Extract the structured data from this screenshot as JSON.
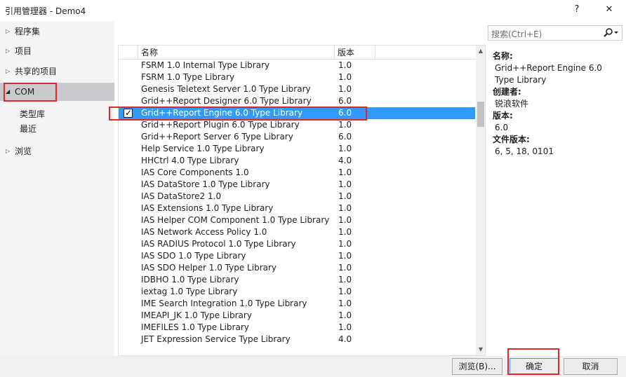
{
  "window": {
    "title": "引用管理器 - Demo4",
    "help_label": "?",
    "close_label": "✕"
  },
  "sidebar": {
    "items": [
      {
        "label": "程序集",
        "arrow": "▷"
      },
      {
        "label": "项目",
        "arrow": "▷"
      },
      {
        "label": "共享的项目",
        "arrow": "▷"
      },
      {
        "label": "COM",
        "arrow": "◢"
      },
      {
        "label": "浏览",
        "arrow": "▷"
      }
    ],
    "sub_items": [
      "类型库",
      "最近"
    ]
  },
  "list": {
    "columns": [
      "名称",
      "版本"
    ],
    "rows": [
      {
        "name": "FSRM 1.0 Internal Type Library",
        "version": "1.0"
      },
      {
        "name": "FSRM 1.0 Type Library",
        "version": "1.0"
      },
      {
        "name": "Genesis Teletext Server 1.0 Type Library",
        "version": "1.0"
      },
      {
        "name": "Grid++Report Designer 6.0 Type Library",
        "version": "6.0"
      },
      {
        "name": "Grid++Report Engine 6.0 Type Library",
        "version": "6.0",
        "checked": true
      },
      {
        "name": "Grid++Report Plugin 6.0 Type Library",
        "version": "1.0"
      },
      {
        "name": "Grid++Report Server 6 Type Library",
        "version": "6.0"
      },
      {
        "name": "Help Service 1.0 Type Library",
        "version": "1.0"
      },
      {
        "name": "HHCtrl 4.0 Type Library",
        "version": "4.0"
      },
      {
        "name": "IAS Core Components 1.0",
        "version": "1.0"
      },
      {
        "name": "IAS DataStore 1.0 Type Library",
        "version": "1.0"
      },
      {
        "name": "IAS DataStore2 1.0",
        "version": "1.0"
      },
      {
        "name": "IAS Extensions 1.0 Type Library",
        "version": "1.0"
      },
      {
        "name": "IAS Helper COM Component 1.0 Type Library",
        "version": "1.0"
      },
      {
        "name": "IAS Network Access Policy 1.0",
        "version": "1.0"
      },
      {
        "name": "IAS RADIUS Protocol 1.0 Type Library",
        "version": "1.0"
      },
      {
        "name": "IAS SDO 1.0 Type Library",
        "version": "1.0"
      },
      {
        "name": "IAS SDO Helper 1.0 Type Library",
        "version": "1.0"
      },
      {
        "name": "IDBHO 1.0 Type Library",
        "version": "1.0"
      },
      {
        "name": "iextag 1.0 Type Library",
        "version": "1.0"
      },
      {
        "name": "IME Search Integration 1.0 Type Library",
        "version": "1.0"
      },
      {
        "name": "IMEAPI_JK 1.0 Type Library",
        "version": "1.0"
      },
      {
        "name": "IMEFILES 1.0 Type Library",
        "version": "1.0"
      },
      {
        "name": "JET Expression Service Type Library",
        "version": "4.0"
      }
    ],
    "selected_index": 4
  },
  "search": {
    "placeholder": "搜索(Ctrl+E)"
  },
  "details": {
    "name_label": "名称:",
    "name_value": "Grid++Report Engine 6.0 Type Library",
    "creator_label": "创建者:",
    "creator_value": "锐浪软件",
    "version_label": "版本:",
    "version_value": "6.0",
    "file_version_label": "文件版本:",
    "file_version_value": "6, 5, 18, 0101"
  },
  "footer": {
    "browse_label": "浏览(B)...",
    "ok_label": "确定",
    "cancel_label": "取消"
  },
  "colors": {
    "selection": "#3399ff",
    "highlight_box": "#e02828",
    "sidebar_bg": "#f5f5f5",
    "sidebar_selected": "#c9c9d0"
  }
}
